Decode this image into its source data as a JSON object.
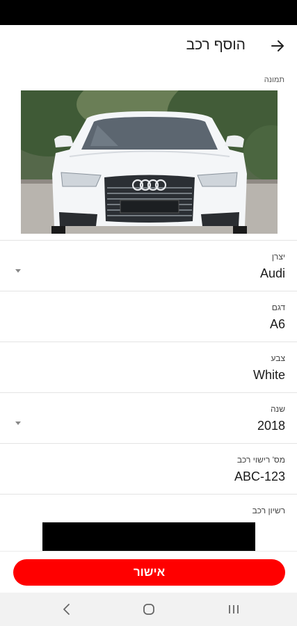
{
  "header": {
    "title": "הוסף רכב",
    "back_icon": "arrow-back-icon"
  },
  "photo": {
    "label": "תמונה",
    "subject": "white Audi front view"
  },
  "fields": [
    {
      "label": "יצרן",
      "value": "Audi",
      "dropdown": true
    },
    {
      "label": "דגם",
      "value": "A6",
      "dropdown": false
    },
    {
      "label": "צבע",
      "value": "White",
      "dropdown": false
    },
    {
      "label": "שנה",
      "value": "2018",
      "dropdown": true
    },
    {
      "label": "מס' רישוי רכב",
      "value": "ABC-123",
      "dropdown": false
    }
  ],
  "license": {
    "label": "רשיון רכב"
  },
  "footer": {
    "confirm_label": "אישור"
  },
  "system_nav": {
    "back": "back-icon",
    "home": "home-icon",
    "recents": "recents-icon"
  },
  "colors": {
    "accent": "#ff0000",
    "status_bar": "#000000",
    "nav_bar": "#f2f2f2",
    "divider": "#e4e4e4"
  }
}
